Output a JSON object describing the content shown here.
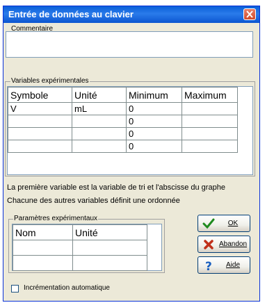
{
  "window": {
    "title": "Entrée de données au clavier"
  },
  "commentaire": {
    "legend": "Commentaire",
    "value": ""
  },
  "variables": {
    "legend": "Variables expérimentales",
    "headers": [
      "Symbole",
      "Unité",
      "Minimum",
      "Maximum"
    ],
    "rows": [
      [
        "V",
        "mL",
        "0",
        ""
      ],
      [
        "",
        "",
        "0",
        ""
      ],
      [
        "",
        "",
        "0",
        ""
      ],
      [
        "",
        "",
        "0",
        ""
      ]
    ]
  },
  "info": {
    "line1": "La première variable est la variable de tri et l'abscisse du graphe",
    "line2": "Chacune des autres variables définit une ordonnée"
  },
  "parametres": {
    "legend": "Paramètres expérimentaux",
    "headers": [
      "Nom",
      "Unité"
    ],
    "rows": [
      [
        "",
        ""
      ],
      [
        "",
        ""
      ]
    ]
  },
  "buttons": {
    "ok": "OK",
    "abandon": "Abandon",
    "aide": "Aide"
  },
  "options": {
    "auto_increment_label": "Incrémentation automatique",
    "auto_increment_checked": false
  },
  "colors": {
    "titlebar": "#0a5fd8",
    "dialog_bg": "#ece9d8",
    "ok_icon": "#1f8a1f",
    "abandon_icon": "#c0301a",
    "aide_icon": "#1a5fbf"
  }
}
